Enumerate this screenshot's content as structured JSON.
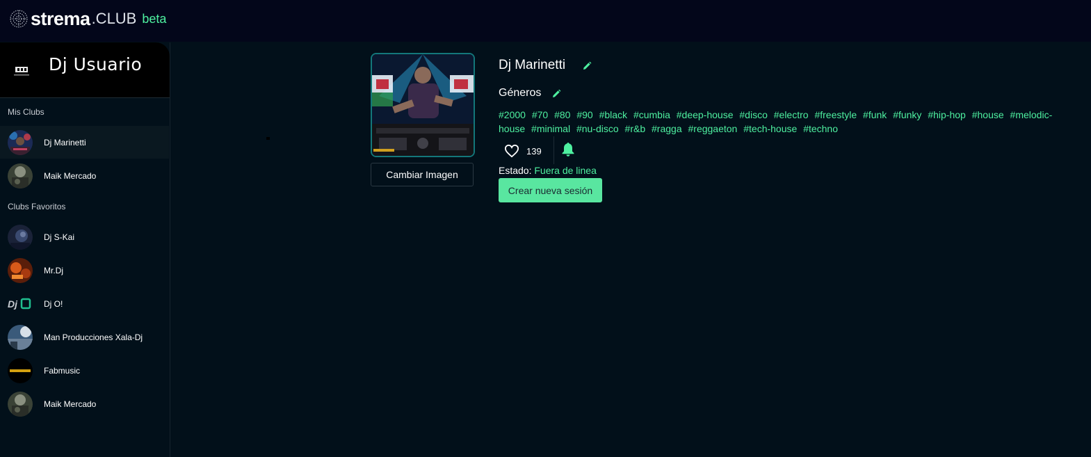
{
  "header": {
    "logo_strema": "strema",
    "logo_club": ".CLUB",
    "logo_beta": "beta"
  },
  "sidebar": {
    "user_name": "Dj Usuario",
    "mis_clubs_label": "Mis Clubs",
    "mis_clubs": [
      {
        "name": "Dj Marinetti",
        "active": true
      },
      {
        "name": "Maik Mercado",
        "active": false
      }
    ],
    "favoritos_label": "Clubs Favoritos",
    "favoritos": [
      {
        "name": "Dj S-Kai"
      },
      {
        "name": "Mr.Dj"
      },
      {
        "name": "Dj O!"
      },
      {
        "name": "Man Producciones Xala-Dj"
      },
      {
        "name": "Fabmusic"
      },
      {
        "name": "Maik Mercado"
      }
    ]
  },
  "profile": {
    "change_image_label": "Cambiar Imagen",
    "club_name": "Dj Marinetti",
    "genres_label": "Géneros",
    "tags": [
      "#2000",
      "#70",
      "#80",
      "#90",
      "#black",
      "#cumbia",
      "#deep-house",
      "#disco",
      "#electro",
      "#freestyle",
      "#funk",
      "#funky",
      "#hip-hop",
      "#house",
      "#melodic-house",
      "#minimal",
      "#nu-disco",
      "#r&b",
      "#ragga",
      "#reggaeton",
      "#tech-house",
      "#techno"
    ],
    "likes": "139",
    "status_label": "Estado:",
    "status_value": "Fuera de linea",
    "new_session_label": "Crear nueva sesión"
  },
  "colors": {
    "accent": "#4ef0a0",
    "button": "#59e6a0",
    "background": "#02101a",
    "topbar": "#03061a"
  }
}
